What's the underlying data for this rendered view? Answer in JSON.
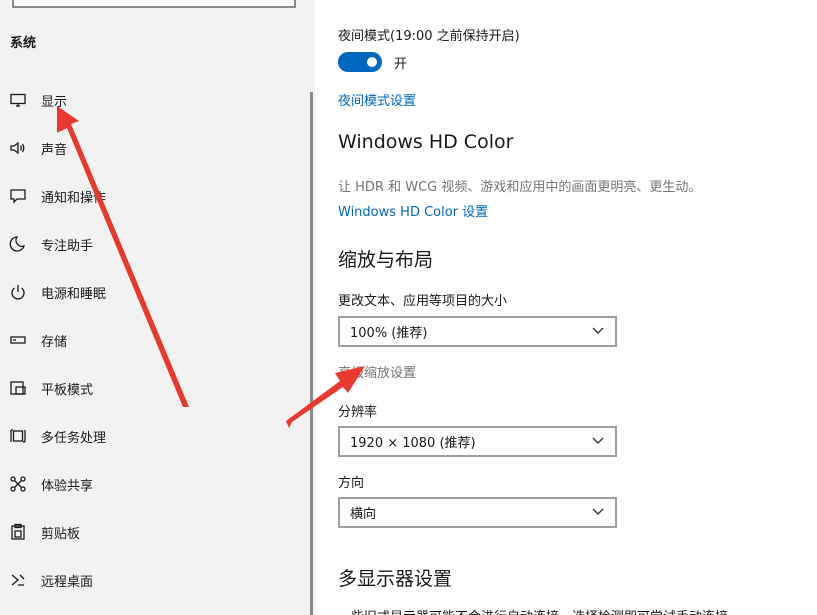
{
  "sidebar": {
    "section_title": "系统",
    "items": [
      {
        "label": "显示",
        "icon": "monitor-icon"
      },
      {
        "label": "声音",
        "icon": "speaker-icon"
      },
      {
        "label": "通知和操作",
        "icon": "notification-icon"
      },
      {
        "label": "专注助手",
        "icon": "moon-icon"
      },
      {
        "label": "电源和睡眠",
        "icon": "power-icon"
      },
      {
        "label": "存储",
        "icon": "storage-icon"
      },
      {
        "label": "平板模式",
        "icon": "tablet-icon"
      },
      {
        "label": "多任务处理",
        "icon": "multitask-icon"
      },
      {
        "label": "体验共享",
        "icon": "share-icon"
      },
      {
        "label": "剪贴板",
        "icon": "clipboard-icon"
      },
      {
        "label": "远程桌面",
        "icon": "remote-desktop-icon"
      }
    ]
  },
  "night_light": {
    "label": "夜间模式(19:00 之前保持开启)",
    "toggle_state": "开",
    "settings_link": "夜间模式设置"
  },
  "hd_color": {
    "heading": "Windows HD Color",
    "description": "让 HDR 和 WCG 视频、游戏和应用中的画面更明亮、更生动。",
    "settings_link": "Windows HD Color 设置"
  },
  "scale_layout": {
    "heading": "缩放与布局",
    "scale_label": "更改文本、应用等项目的大小",
    "scale_value": "100% (推荐)",
    "advanced_link": "高级缩放设置",
    "resolution_label": "分辨率",
    "resolution_value": "1920 × 1080 (推荐)",
    "orientation_label": "方向",
    "orientation_value": "横向"
  },
  "multi_display": {
    "heading": "多显示器设置",
    "description": "一些旧式显示器可能不会进行自动连接。选择检测即可尝试手动连接。"
  },
  "colors": {
    "accent": "#0067c0",
    "annotation": "#e8382f",
    "sidebar_bg": "#f2f2f2"
  }
}
